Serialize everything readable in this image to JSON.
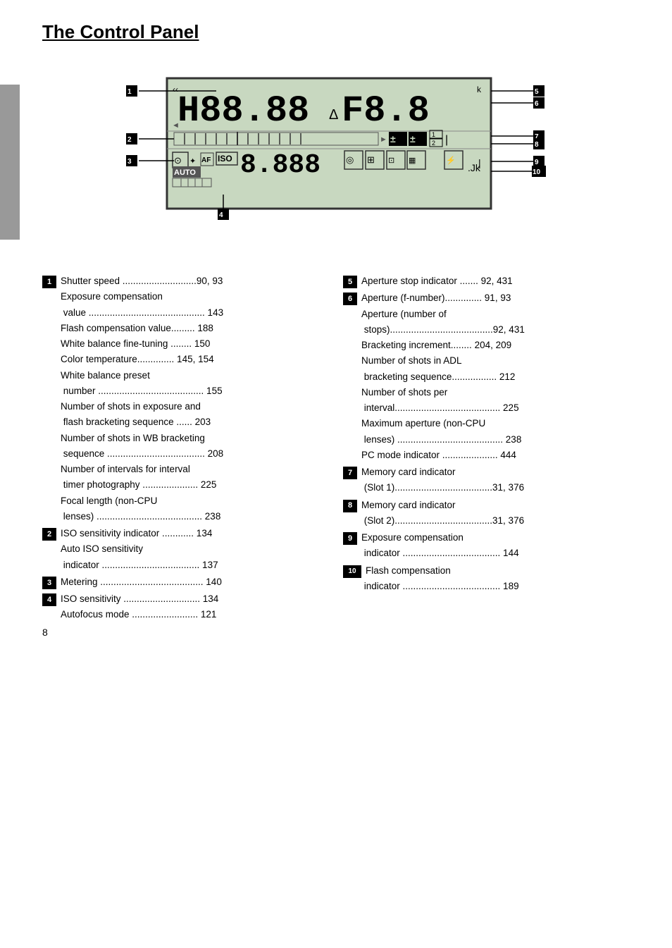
{
  "title": "The Control Panel",
  "pageNum": "8",
  "diagram": {
    "labels": {
      "n1": "1",
      "n2": "2",
      "n3": "3",
      "n4": "4",
      "n5": "5",
      "n6": "6",
      "n7": "7",
      "n8": "8",
      "n9": "9",
      "n10": "10"
    },
    "lcd": {
      "shutter": "H88.88",
      "aperture": "ΔF8.8",
      "isoDigits": "8.888",
      "isoLabel": "ISO",
      "autoLabel": "AUTO"
    }
  },
  "left_column": {
    "entries": [
      {
        "num": "1",
        "items": [
          {
            "text": "Shutter speed",
            "dots": "............................",
            "page": "90, 93"
          },
          {
            "text": "Exposure compensation\n value",
            "dots": "..........................................",
            "page": "143"
          },
          {
            "text": "Flash compensation value",
            "dots": ".........",
            "page": "188"
          },
          {
            "text": "White balance fine-tuning",
            "dots": "........",
            "page": "150"
          },
          {
            "text": "Color temperature",
            "dots": "..............",
            "page": "145, 154"
          },
          {
            "text": "White balance preset\n number",
            "dots": ".......................................",
            "page": "155"
          },
          {
            "text": "Number of shots in exposure and\n flash bracketing sequence",
            "dots": "......",
            "page": "203"
          },
          {
            "text": "Number of shots in WB bracketing\n sequence",
            "dots": ".....................................",
            "page": "208"
          },
          {
            "text": "Number of intervals for interval\n timer photography",
            "dots": "...................",
            "page": "225"
          },
          {
            "text": "Focal length (non-CPU\n lenses)",
            "dots": "........................................",
            "page": "238"
          }
        ]
      },
      {
        "num": "2",
        "items": [
          {
            "text": "ISO sensitivity indicator",
            "dots": "..........",
            "page": "134"
          },
          {
            "text": "Auto ISO sensitivity\n indicator",
            "dots": ".....................................",
            "page": "137"
          }
        ]
      },
      {
        "num": "3",
        "items": [
          {
            "text": "Metering",
            "dots": ".......................................",
            "page": "140"
          }
        ]
      },
      {
        "num": "4",
        "items": [
          {
            "text": "ISO sensitivity",
            "dots": ".......................",
            "page": "134"
          },
          {
            "text": "Autofocus mode",
            "dots": ".........................",
            "page": "121"
          }
        ]
      }
    ]
  },
  "right_column": {
    "entries": [
      {
        "num": "5",
        "items": [
          {
            "text": "Aperture stop indicator",
            "dots": ".......",
            "page": "92, 431"
          }
        ]
      },
      {
        "num": "6",
        "items": [
          {
            "text": "Aperture (f-number)",
            "dots": "..............",
            "page": "91, 93"
          },
          {
            "text": "Aperture (number of\n stops)",
            "dots": ".....................................",
            "page": "92, 431"
          },
          {
            "text": "Bracketing increment",
            "dots": "........",
            "page": "204, 209"
          },
          {
            "text": "Number of shots in ADL\n bracketing sequence",
            "dots": "................",
            "page": "212"
          },
          {
            "text": "Number of shots per\n interval",
            "dots": "........................................",
            "page": "225"
          },
          {
            "text": "Maximum aperture (non-CPU\n lenses)",
            "dots": "........................................",
            "page": "238"
          },
          {
            "text": "PC mode indicator",
            "dots": "...................",
            "page": "444"
          }
        ]
      },
      {
        "num": "7",
        "items": [
          {
            "text": "Memory card indicator\n (Slot 1)",
            "dots": ".....................................",
            "page": "31, 376"
          }
        ]
      },
      {
        "num": "8",
        "items": [
          {
            "text": "Memory card indicator\n (Slot 2)",
            "dots": ".....................................",
            "page": "31, 376"
          }
        ]
      },
      {
        "num": "9",
        "items": [
          {
            "text": "Exposure compensation\n indicator",
            "dots": ".....................................",
            "page": "144"
          }
        ]
      },
      {
        "num": "10",
        "items": [
          {
            "text": "Flash compensation\n indicator",
            "dots": ".....................................",
            "page": "189"
          }
        ]
      }
    ]
  }
}
